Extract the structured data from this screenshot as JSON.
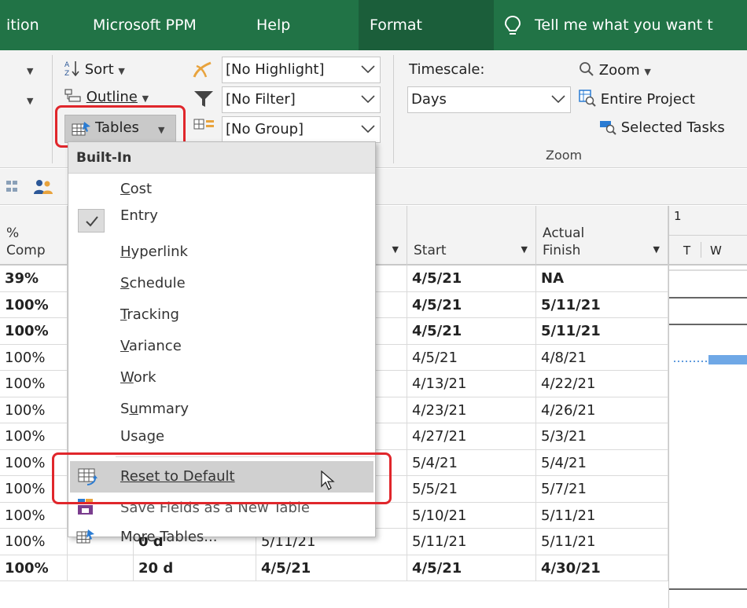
{
  "tabs": [
    {
      "label": "ition"
    },
    {
      "label": "Microsoft PPM"
    },
    {
      "label": "Help"
    },
    {
      "label": "Format"
    },
    {
      "label": "Tell me what you want t"
    }
  ],
  "ribbon": {
    "sort_label": "Sort",
    "outline_label": "Outline",
    "tables_label": "Tables",
    "highlight_value": "[No Highlight]",
    "filter_value": "[No Filter]",
    "group_value": "[No Group]",
    "timescale_label": "Timescale:",
    "timescale_value": "Days",
    "zoom_label": "Zoom",
    "entire_project_label": "Entire Project",
    "selected_tasks_label": "Selected Tasks",
    "zoom_group_label": "Zoom"
  },
  "grid": {
    "headers": {
      "pct_line1": "%",
      "pct_line2": "Comp",
      "start": "Start",
      "finish_line1": "Actual",
      "finish_line2": "Finish",
      "gantt_top": "1",
      "gantt_t": "T",
      "gantt_w": "W"
    },
    "rows": [
      {
        "pct": "39%",
        "dur": "",
        "astart": "",
        "start": "4/5/21",
        "finish": "NA",
        "bold": true
      },
      {
        "pct": "100%",
        "dur": "",
        "astart": "",
        "start": "4/5/21",
        "finish": "5/11/21",
        "bold": true
      },
      {
        "pct": "100%",
        "dur": "",
        "astart": "",
        "start": "4/5/21",
        "finish": "5/11/21",
        "bold": true
      },
      {
        "pct": "100%",
        "dur": "",
        "astart": "",
        "start": "4/5/21",
        "finish": "4/8/21",
        "bold": false
      },
      {
        "pct": "100%",
        "dur": "",
        "astart": "",
        "start": "4/13/21",
        "finish": "4/22/21",
        "bold": false
      },
      {
        "pct": "100%",
        "dur": "",
        "astart": "",
        "start": "4/23/21",
        "finish": "4/26/21",
        "bold": false
      },
      {
        "pct": "100%",
        "dur": "",
        "astart": "",
        "start": "4/27/21",
        "finish": "5/3/21",
        "bold": false
      },
      {
        "pct": "100%",
        "dur": "",
        "astart": "",
        "start": "5/4/21",
        "finish": "5/4/21",
        "bold": false
      },
      {
        "pct": "100%",
        "dur": "",
        "astart": "",
        "start": "5/5/21",
        "finish": "5/7/21",
        "bold": false
      },
      {
        "pct": "100%",
        "dur": "",
        "astart": "",
        "start": "5/10/21",
        "finish": "5/11/21",
        "bold": false
      },
      {
        "pct": "100%",
        "dur": "0 d",
        "astart": "5/11/21",
        "start": "5/11/21",
        "finish": "5/11/21",
        "bold": false
      },
      {
        "pct": "100%",
        "dur": "20 d",
        "astart": "4/5/21",
        "start": "4/5/21",
        "finish": "4/30/21",
        "bold": true
      }
    ]
  },
  "menu": {
    "header": "Built-In",
    "items": [
      {
        "pre": "",
        "key": "C",
        "post": "ost"
      },
      {
        "pre": "",
        "key": "",
        "post": "Entry"
      },
      {
        "pre": "",
        "key": "H",
        "post": "yperlink"
      },
      {
        "pre": "",
        "key": "S",
        "post": "chedule"
      },
      {
        "pre": "",
        "key": "T",
        "post": "racking"
      },
      {
        "pre": "",
        "key": "V",
        "post": "ariance"
      },
      {
        "pre": "",
        "key": "W",
        "post": "ork"
      },
      {
        "pre": "S",
        "key": "u",
        "post": "mmary"
      },
      {
        "pre": "Usa",
        "key": "g",
        "post": "e"
      }
    ],
    "reset_label": "Reset to Default",
    "save_label": "Save Fields as a New Table",
    "more_label": "More Tables..."
  },
  "colors": {
    "tabbar": "#217346",
    "highlight_box": "#e0262b"
  }
}
